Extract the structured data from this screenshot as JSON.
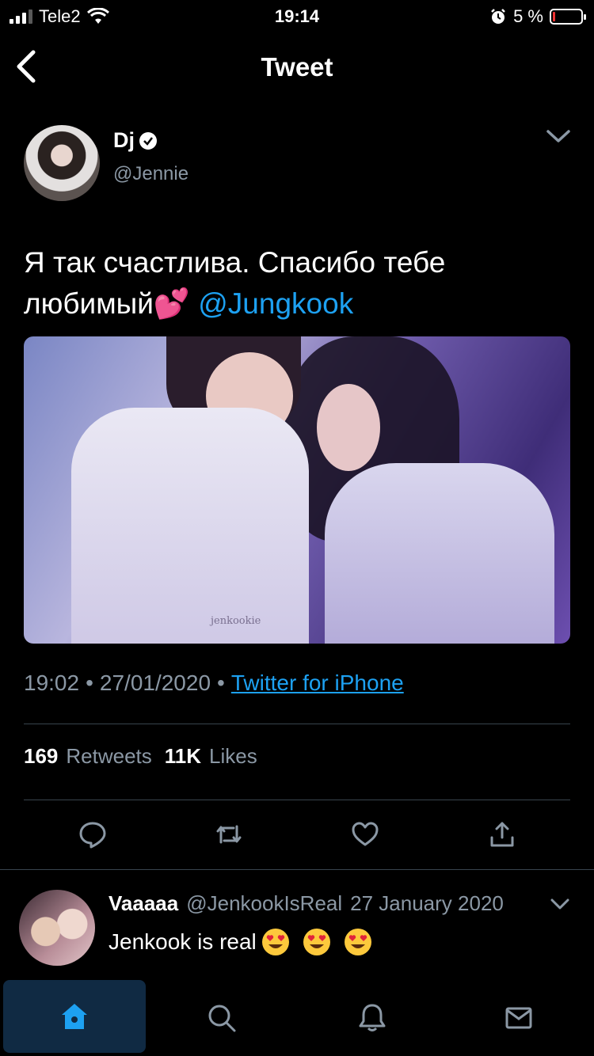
{
  "status_bar": {
    "carrier": "Tele2",
    "time": "19:14",
    "battery": "5 %"
  },
  "nav": {
    "title": "Tweet"
  },
  "tweet": {
    "author_name": "Dj",
    "author_handle": "@Jennie",
    "text": "Я так счастлива. Спасибо тебе любимый💕",
    "mention": "@Jungkook",
    "image_watermark": "jenkookie",
    "time": "19:02",
    "date": "27/01/2020",
    "source": "Twitter for iPhone",
    "retweets_count": "169",
    "retweets_label": "Retweets",
    "likes_count": "11K",
    "likes_label": "Likes"
  },
  "reply": {
    "name": "Vaaaaa",
    "handle": "@JenkookIsReal",
    "date": "27 January 2020",
    "text": "Jenkook is real"
  },
  "icons": {
    "reply": "comment-icon",
    "retweet": "retweet-icon",
    "like": "heart-icon",
    "share": "share-icon",
    "home": "home-icon",
    "search": "search-icon",
    "notifications": "bell-icon",
    "messages": "mail-icon"
  },
  "colors": {
    "accent": "#1da1f2",
    "muted": "#8b98a5",
    "divider": "#38444d",
    "background": "#000000"
  }
}
